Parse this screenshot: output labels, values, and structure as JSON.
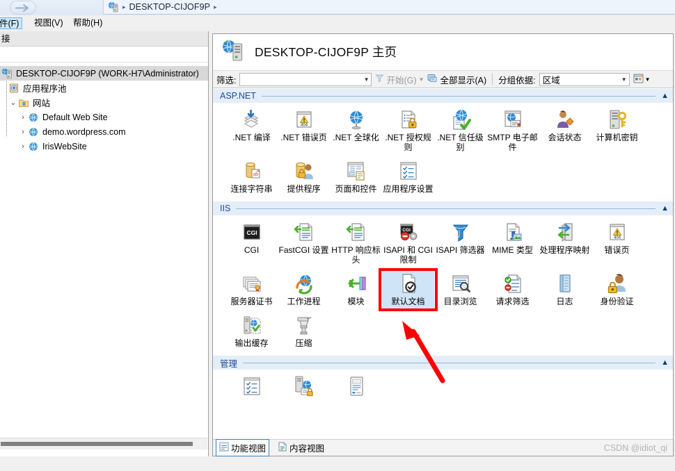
{
  "window": {
    "breadcrumb": {
      "server": "DESKTOP-CIJOF9P",
      "sep1": "▸",
      "sep2": "▸",
      "icon": "server-globe-icon"
    },
    "back_icon": "back-arrow-icon"
  },
  "menubar": {
    "items": [
      {
        "label": "件(F)",
        "underline": "F",
        "selected": true
      },
      {
        "label": "视图(V)",
        "underline": "V",
        "selected": false
      },
      {
        "label": "帮助(H)",
        "underline": "H",
        "selected": false
      }
    ]
  },
  "sidebar": {
    "header": "接",
    "tree": [
      {
        "label": "DESKTOP-CIJOF9P (WORK-H7\\Administrator)",
        "level": 0,
        "expander": "",
        "icon": "server-icon",
        "selected": true
      },
      {
        "label": "应用程序池",
        "level": 1,
        "expander": "",
        "icon": "app-pool-icon",
        "selected": false
      },
      {
        "label": "网站",
        "level": 1,
        "expander": "⌄",
        "icon": "sites-folder-icon",
        "selected": false
      },
      {
        "label": "Default Web Site",
        "level": 2,
        "expander": "›",
        "icon": "website-globe-icon",
        "selected": false
      },
      {
        "label": "demo.wordpress.com",
        "level": 2,
        "expander": "›",
        "icon": "website-globe-icon",
        "selected": false
      },
      {
        "label": "IrisWebSite",
        "level": 2,
        "expander": "›",
        "icon": "website-globe-icon",
        "selected": false
      }
    ]
  },
  "content": {
    "title": "DESKTOP-CIJOF9P 主页",
    "title_icon": "server-home-icon",
    "toolbar": {
      "filter_label": "筛选:",
      "filter_value": "",
      "start_label": "开始(G)",
      "start_icon": "funnel-icon",
      "showall_label": "全部显示(A)",
      "showall_icon": "show-all-icon",
      "groupby_label": "分组依据:",
      "groupby_value": "区域",
      "viewmode_icon": "view-mode-icon"
    },
    "sections": [
      {
        "name": "ASP.NET",
        "collapse_icon": "chevron-up-icon",
        "tiles": [
          {
            "label": ".NET 编译",
            "icon": "net-compile-icon"
          },
          {
            "label": ".NET 错误页",
            "icon": "net-error-page-icon"
          },
          {
            "label": ".NET 全球化",
            "icon": "net-globalization-icon"
          },
          {
            "label": ".NET 授权规则",
            "icon": "net-authorization-icon"
          },
          {
            "label": ".NET 信任级别",
            "icon": "net-trust-level-icon"
          },
          {
            "label": "SMTP 电子邮件",
            "icon": "smtp-email-icon"
          },
          {
            "label": "会话状态",
            "icon": "session-state-icon"
          },
          {
            "label": "计算机密钥",
            "icon": "machine-key-icon"
          },
          {
            "label": "连接字符串",
            "icon": "connection-strings-icon"
          },
          {
            "label": "提供程序",
            "icon": "providers-icon"
          },
          {
            "label": "页面和控件",
            "icon": "pages-controls-icon"
          },
          {
            "label": "应用程序设置",
            "icon": "app-settings-icon"
          }
        ]
      },
      {
        "name": "IIS",
        "collapse_icon": "chevron-up-icon",
        "tiles": [
          {
            "label": "CGI",
            "icon": "cgi-icon"
          },
          {
            "label": "FastCGI 设置",
            "icon": "fastcgi-settings-icon"
          },
          {
            "label": "HTTP 响应标头",
            "icon": "http-response-headers-icon"
          },
          {
            "label": "ISAPI 和 CGI 限制",
            "icon": "isapi-cgi-restrictions-icon"
          },
          {
            "label": "ISAPI 筛选器",
            "icon": "isapi-filters-icon"
          },
          {
            "label": "MIME 类型",
            "icon": "mime-types-icon"
          },
          {
            "label": "处理程序映射",
            "icon": "handler-mappings-icon"
          },
          {
            "label": "错误页",
            "icon": "error-pages-icon"
          },
          {
            "label": "服务器证书",
            "icon": "server-certificates-icon"
          },
          {
            "label": "工作进程",
            "icon": "worker-processes-icon"
          },
          {
            "label": "模块",
            "icon": "modules-icon"
          },
          {
            "label": "默认文档",
            "icon": "default-document-icon",
            "selected": true
          },
          {
            "label": "目录浏览",
            "icon": "directory-browsing-icon"
          },
          {
            "label": "请求筛选",
            "icon": "request-filtering-icon"
          },
          {
            "label": "日志",
            "icon": "logging-icon"
          },
          {
            "label": "身份验证",
            "icon": "authentication-icon"
          },
          {
            "label": "输出缓存",
            "icon": "output-caching-icon"
          },
          {
            "label": "压缩",
            "icon": "compression-icon"
          }
        ]
      },
      {
        "name": "管理",
        "collapse_icon": "chevron-up-icon",
        "tiles": [
          {
            "label": "",
            "icon": "configuration-editor-icon"
          },
          {
            "label": "",
            "icon": "feature-delegation-icon"
          },
          {
            "label": "",
            "icon": "shared-configuration-icon"
          }
        ]
      }
    ],
    "view_tabs": [
      {
        "label": "功能视图",
        "icon": "features-view-icon",
        "active": true
      },
      {
        "label": "内容视图",
        "icon": "content-view-icon",
        "active": false
      }
    ]
  },
  "annotation": {
    "highlight_color": "#ff0000",
    "selection_color": "#cfe4f7",
    "arrow": "red-arrow-pointing-to-default-document"
  },
  "watermark": "CSDN @idiot_qi"
}
